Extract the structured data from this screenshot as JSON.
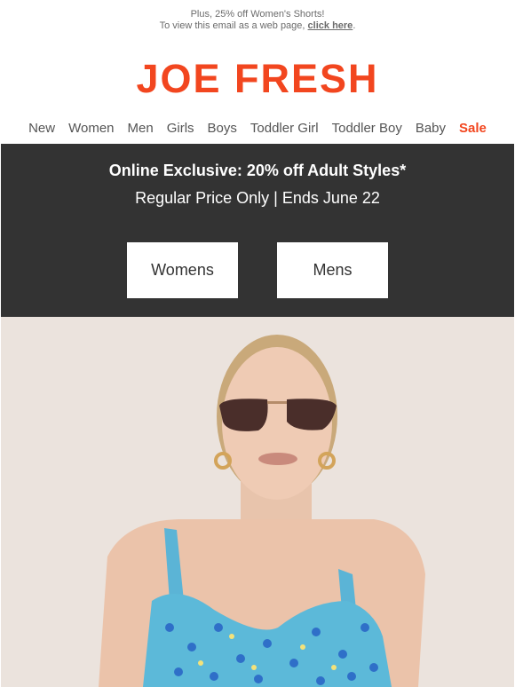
{
  "preheader": {
    "line1": "Plus, 25% off Women's Shorts!",
    "line2_prefix": "To view this email as a web page,",
    "link": "click here",
    "line2_suffix": "."
  },
  "brand": {
    "logo_text": "JOE FRESH",
    "accent": "#f2461f"
  },
  "nav": {
    "items": [
      "New",
      "Women",
      "Men",
      "Girls",
      "Boys",
      "Toddler Girl",
      "Toddler Boy",
      "Baby"
    ],
    "sale": "Sale"
  },
  "promo": {
    "headline": "Online Exclusive: 20% off Adult Styles*",
    "subline": "Regular Price Only | Ends June 22",
    "buttons": {
      "womens": "Womens",
      "mens": "Mens"
    },
    "background": "#333333"
  },
  "hero": {
    "background": "#ebe3dd"
  }
}
